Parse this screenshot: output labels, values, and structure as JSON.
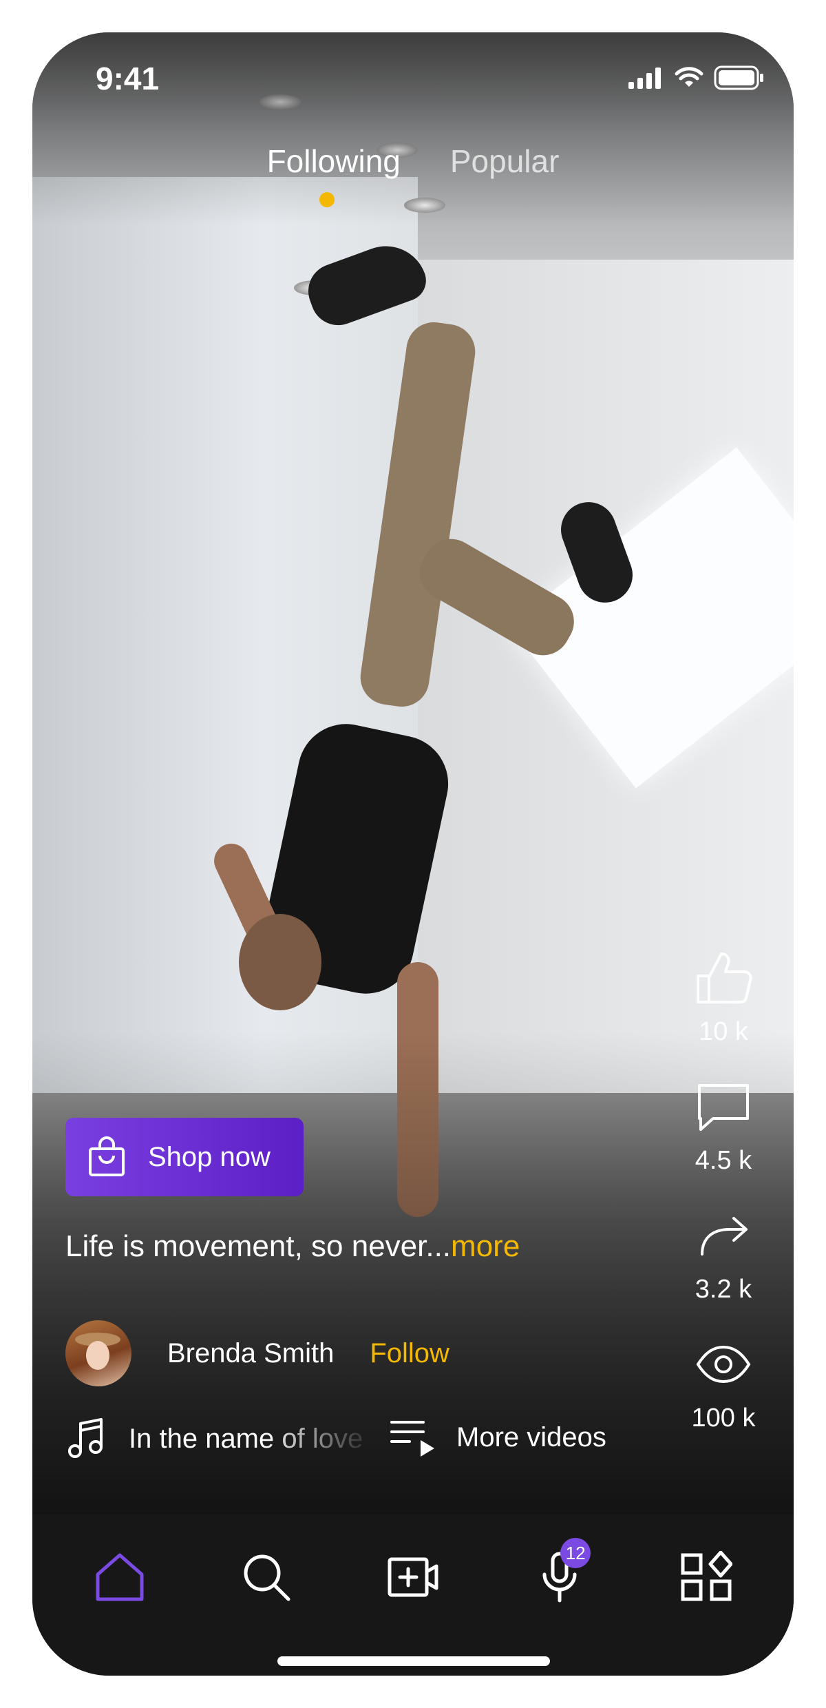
{
  "status_bar": {
    "time": "9:41"
  },
  "feed_tabs": [
    {
      "label": "Following",
      "active": true
    },
    {
      "label": "Popular",
      "active": false
    }
  ],
  "actions": {
    "likes": "10 k",
    "comments": "4.5 k",
    "shares": "3.2 k",
    "views": "100 k"
  },
  "shop_button": {
    "label": "Shop now"
  },
  "caption": {
    "text": "Life is movement, so never...",
    "more_label": "more"
  },
  "author": {
    "name": "Brenda Smith",
    "follow_label": "Follow"
  },
  "music": {
    "song": "In the name of love"
  },
  "more_videos": {
    "label": "More videos"
  },
  "nav": {
    "mic_badge": "12"
  },
  "colors": {
    "accent_yellow": "#f5b800",
    "accent_purple": "#6a2ad6",
    "nav_bg": "#171717"
  },
  "icons": [
    "signal-icon",
    "wifi-icon",
    "battery-icon",
    "like-icon",
    "comment-icon",
    "share-icon",
    "view-icon",
    "shopping-bag-icon",
    "music-note-icon",
    "playlist-icon",
    "home-icon",
    "search-icon",
    "add-video-icon",
    "microphone-icon",
    "apps-icon"
  ]
}
